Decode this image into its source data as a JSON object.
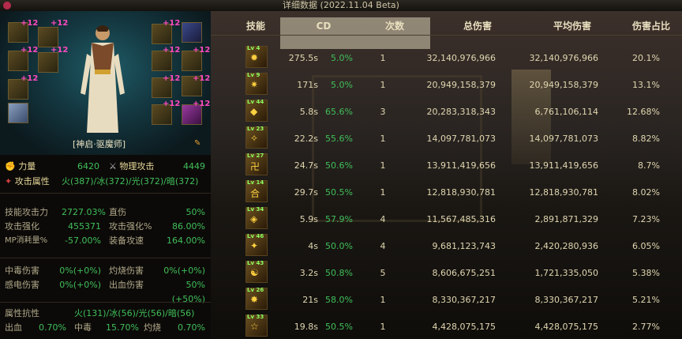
{
  "window": {
    "title": "详细数据 (2022.11.04 Beta)"
  },
  "character": {
    "job": "[神启·驱魔师]",
    "plus_label": "+12"
  },
  "stats": {
    "strength": {
      "label": "力量",
      "value": "6420"
    },
    "phys_atk": {
      "label": "物理攻击",
      "value": "4449"
    },
    "elem_attr": {
      "label": "攻击属性",
      "value": "火(387)/冰(372)/光(372)/暗(372)"
    },
    "skill_atk": {
      "label": "技能攻击力",
      "value": "2727.03%"
    },
    "crit_dmg": {
      "label": "直伤",
      "value": "50%"
    },
    "atk_boost": {
      "label": "攻击强化",
      "value": "455371"
    },
    "atk_boost_pct": {
      "label": "攻击强化%",
      "value": "86.00%"
    },
    "mp_cost": {
      "label": "MP消耗量%",
      "value": "-57.00%"
    },
    "atk_speed": {
      "label": "装备攻速",
      "value": "164.00%"
    },
    "poison": {
      "label": "中毒伤害",
      "value": "0%(+0%)"
    },
    "burn": {
      "label": "灼烧伤害",
      "value": "0%(+0%)"
    },
    "shock": {
      "label": "感电伤害",
      "value": "0%(+0%)"
    },
    "bleed": {
      "label": "出血伤害",
      "value": "50%(+50%)"
    },
    "resist": {
      "label": "属性抗性",
      "value": "火(131)/冰(56)/光(56)/暗(56)"
    },
    "bleed_rate": {
      "label": "出血",
      "value": "0.70%"
    },
    "poison_rate": {
      "label": "中毒",
      "value": "15.70%"
    },
    "burn_rate": {
      "label": "灼烧",
      "value": "0.70%"
    }
  },
  "table": {
    "headers": [
      "技能",
      "CD",
      "次数",
      "总伤害",
      "平均伤害",
      "伤害占比"
    ],
    "rows": [
      {
        "lv": "Lv 4",
        "cd": "275.5s",
        "cdr": "5.0%",
        "count": "1",
        "total": "32,140,976,966",
        "avg": "32,140,976,966",
        "share": "20.1%"
      },
      {
        "lv": "Lv 9",
        "cd": "171s",
        "cdr": "5.0%",
        "count": "1",
        "total": "20,949,158,379",
        "avg": "20,949,158,379",
        "share": "13.1%"
      },
      {
        "lv": "Lv 44",
        "cd": "5.8s",
        "cdr": "65.6%",
        "count": "3",
        "total": "20,283,318,343",
        "avg": "6,761,106,114",
        "share": "12.68%"
      },
      {
        "lv": "Lv 23",
        "cd": "22.2s",
        "cdr": "55.6%",
        "count": "1",
        "total": "14,097,781,073",
        "avg": "14,097,781,073",
        "share": "8.82%"
      },
      {
        "lv": "Lv 27",
        "cd": "24.7s",
        "cdr": "50.6%",
        "count": "1",
        "total": "13,911,419,656",
        "avg": "13,911,419,656",
        "share": "8.7%"
      },
      {
        "lv": "Lv 14",
        "cd": "29.7s",
        "cdr": "50.5%",
        "count": "1",
        "total": "12,818,930,781",
        "avg": "12,818,930,781",
        "share": "8.02%"
      },
      {
        "lv": "Lv 34",
        "cd": "5.9s",
        "cdr": "57.9%",
        "count": "4",
        "total": "11,567,485,316",
        "avg": "2,891,871,329",
        "share": "7.23%"
      },
      {
        "lv": "Lv 46",
        "cd": "4s",
        "cdr": "50.0%",
        "count": "4",
        "total": "9,681,123,743",
        "avg": "2,420,280,936",
        "share": "6.05%"
      },
      {
        "lv": "Lv 43",
        "cd": "3.2s",
        "cdr": "50.8%",
        "count": "5",
        "total": "8,606,675,251",
        "avg": "1,721,335,050",
        "share": "5.38%"
      },
      {
        "lv": "Lv 26",
        "cd": "21s",
        "cdr": "58.0%",
        "count": "1",
        "total": "8,330,367,217",
        "avg": "8,330,367,217",
        "share": "5.21%"
      },
      {
        "lv": "Lv 33",
        "cd": "19.8s",
        "cdr": "50.5%",
        "count": "1",
        "total": "4,428,075,175",
        "avg": "4,428,075,175",
        "share": "2.77%"
      }
    ]
  }
}
